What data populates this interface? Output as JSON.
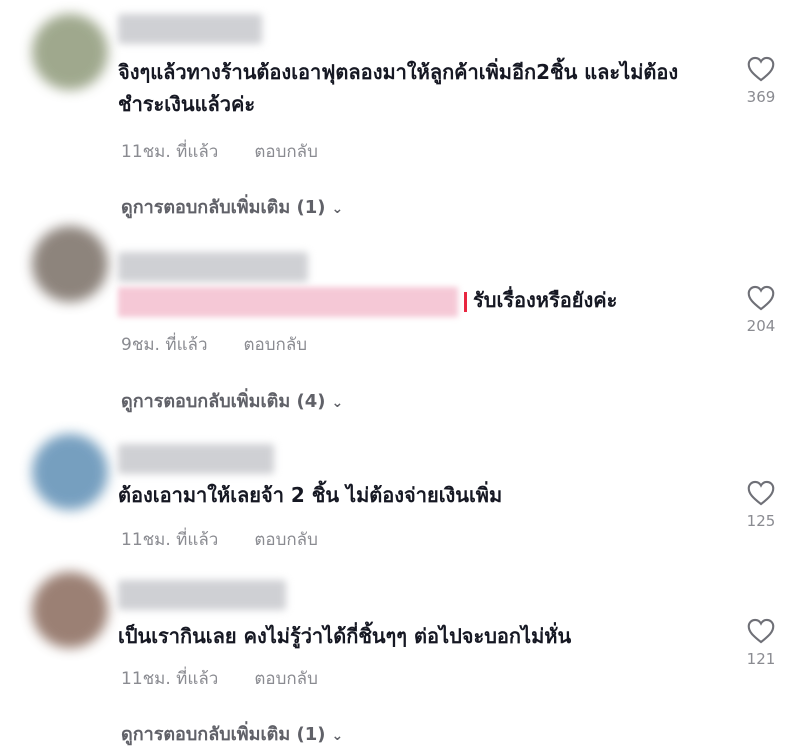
{
  "comments": [
    {
      "text": "จิงๆแล้วทางร้านต้องเอาฟุตลองมาให้ลูกค้าเพิ่มอีก2ชิ้น และไม่ต้องชำระเงินแล้วค่ะ",
      "time": "11ชม. ที่แล้ว",
      "reply": "ตอบกลับ",
      "likes": "369",
      "more": "ดูการตอบกลับเพิ่มเติม (1)",
      "avatar_color": "#8f9a7a"
    },
    {
      "text": "รับเรื่องหรือยังค่ะ",
      "time": "9ชม. ที่แล้ว",
      "reply": "ตอบกลับ",
      "likes": "204",
      "more": "ดูการตอบกลับเพิ่มเติม (4)",
      "avatar_color": "#7a6f66"
    },
    {
      "text": "ต้องเอามาให้เลยจ้า 2 ชิ้น ไม่ต้องจ่ายเงินเพิ่ม",
      "time": "11ชม. ที่แล้ว",
      "reply": "ตอบกลับ",
      "likes": "125",
      "avatar_color": "#5f8fb5"
    },
    {
      "text": "เป็นเรากินเลย คงไม่รู้ว่าได้กี่ชิ้นๆๆ ต่อไปจะบอกไม่หั่น",
      "time": "11ชม. ที่แล้ว",
      "reply": "ตอบกลับ",
      "likes": "121",
      "more": "ดูการตอบกลับเพิ่มเติม (1)",
      "avatar_color": "#8a6a5c"
    }
  ],
  "icons": {
    "like": "heart-outline-icon",
    "expand": "chevron-down-icon"
  },
  "colors": {
    "meta": "#8a8b91",
    "text": "#161823",
    "accent": "#e8253f"
  }
}
